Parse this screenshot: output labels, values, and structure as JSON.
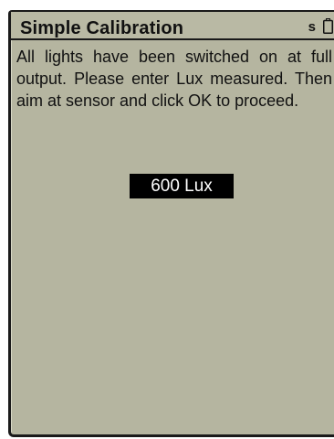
{
  "header": {
    "title": "Simple Calibration",
    "status_letter": "s",
    "battery_icon": "battery-icon"
  },
  "message": {
    "text": "All lights have been switched on at full output. Please enter Lux measured. Then aim at sensor and click OK to proceed."
  },
  "lux_field": {
    "value": "600 Lux"
  },
  "colors": {
    "screen_background": "#b5b5a0",
    "text": "#111111",
    "field_background": "#000000",
    "field_text": "#ffffff"
  }
}
